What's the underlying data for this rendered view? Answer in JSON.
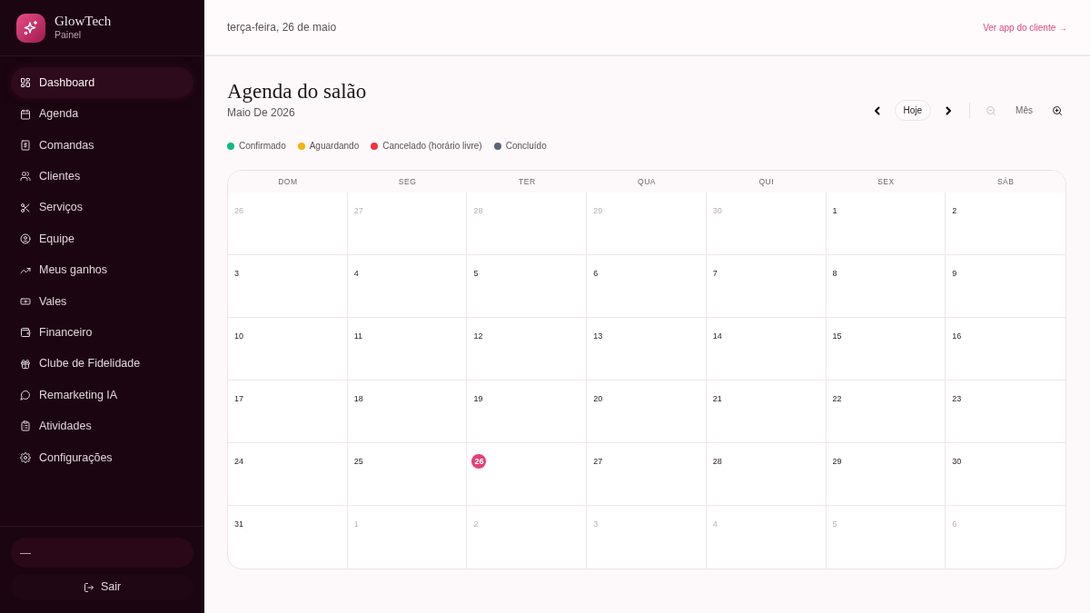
{
  "sidebar": {
    "brand": {
      "name": "GlowTech",
      "subtitle": "Painel"
    },
    "items": [
      {
        "label": "Dashboard",
        "selected": true
      },
      {
        "label": "Agenda",
        "selected": false
      },
      {
        "label": "Comandas",
        "selected": false
      },
      {
        "label": "Clientes",
        "selected": false
      },
      {
        "label": "Serviços",
        "selected": false
      },
      {
        "label": "Equipe",
        "selected": false
      },
      {
        "label": "Meus ganhos",
        "selected": false
      },
      {
        "label": "Vales",
        "selected": false
      },
      {
        "label": "Financeiro",
        "selected": false
      },
      {
        "label": "Clube de Fidelidade",
        "selected": false
      },
      {
        "label": "Remarketing IA",
        "selected": false
      },
      {
        "label": "Atividades",
        "selected": false
      },
      {
        "label": "Configurações",
        "selected": false
      }
    ],
    "user": "—",
    "logout": "Sair"
  },
  "header": {
    "date": "terça-feira, 26 de maio",
    "link": "Ver app do cliente →"
  },
  "page": {
    "title": "Agenda do salão",
    "subtitle": "Maio De 2026"
  },
  "toolbar": {
    "today": "Hoje",
    "view": "Mês",
    "zoom_out": {
      "disabled": true
    },
    "zoom_in": {
      "disabled": false
    }
  },
  "legend": [
    {
      "label": "Confirmado",
      "color": "#10b981"
    },
    {
      "label": "Aguardando",
      "color": "#f5b40a"
    },
    {
      "label": "Cancelado (horário livre)",
      "color": "#ef3340"
    },
    {
      "label": "Concluído",
      "color": "#5b6479"
    }
  ],
  "calendar": {
    "weekdays": [
      "DOM",
      "SEG",
      "TER",
      "QUA",
      "QUI",
      "SEX",
      "SÁB"
    ],
    "weeks": [
      [
        {
          "day": "26",
          "in_month": false,
          "today": false
        },
        {
          "day": "27",
          "in_month": false,
          "today": false
        },
        {
          "day": "28",
          "in_month": false,
          "today": false
        },
        {
          "day": "29",
          "in_month": false,
          "today": false
        },
        {
          "day": "30",
          "in_month": false,
          "today": false
        },
        {
          "day": "1",
          "in_month": true,
          "today": false
        },
        {
          "day": "2",
          "in_month": true,
          "today": false
        }
      ],
      [
        {
          "day": "3",
          "in_month": true,
          "today": false
        },
        {
          "day": "4",
          "in_month": true,
          "today": false
        },
        {
          "day": "5",
          "in_month": true,
          "today": false
        },
        {
          "day": "6",
          "in_month": true,
          "today": false
        },
        {
          "day": "7",
          "in_month": true,
          "today": false
        },
        {
          "day": "8",
          "in_month": true,
          "today": false
        },
        {
          "day": "9",
          "in_month": true,
          "today": false
        }
      ],
      [
        {
          "day": "10",
          "in_month": true,
          "today": false
        },
        {
          "day": "11",
          "in_month": true,
          "today": false
        },
        {
          "day": "12",
          "in_month": true,
          "today": false
        },
        {
          "day": "13",
          "in_month": true,
          "today": false
        },
        {
          "day": "14",
          "in_month": true,
          "today": false
        },
        {
          "day": "15",
          "in_month": true,
          "today": false
        },
        {
          "day": "16",
          "in_month": true,
          "today": false
        }
      ],
      [
        {
          "day": "17",
          "in_month": true,
          "today": false
        },
        {
          "day": "18",
          "in_month": true,
          "today": false
        },
        {
          "day": "19",
          "in_month": true,
          "today": false
        },
        {
          "day": "20",
          "in_month": true,
          "today": false
        },
        {
          "day": "21",
          "in_month": true,
          "today": false
        },
        {
          "day": "22",
          "in_month": true,
          "today": false
        },
        {
          "day": "23",
          "in_month": true,
          "today": false
        }
      ],
      [
        {
          "day": "24",
          "in_month": true,
          "today": false
        },
        {
          "day": "25",
          "in_month": true,
          "today": false
        },
        {
          "day": "26",
          "in_month": true,
          "today": true
        },
        {
          "day": "27",
          "in_month": true,
          "today": false
        },
        {
          "day": "28",
          "in_month": true,
          "today": false
        },
        {
          "day": "29",
          "in_month": true,
          "today": false
        },
        {
          "day": "30",
          "in_month": true,
          "today": false
        }
      ],
      [
        {
          "day": "31",
          "in_month": true,
          "today": false
        },
        {
          "day": "1",
          "in_month": false,
          "today": false
        },
        {
          "day": "2",
          "in_month": false,
          "today": false
        },
        {
          "day": "3",
          "in_month": false,
          "today": false
        },
        {
          "day": "4",
          "in_month": false,
          "today": false
        },
        {
          "day": "5",
          "in_month": false,
          "today": false
        },
        {
          "day": "6",
          "in_month": false,
          "today": false
        }
      ]
    ]
  }
}
